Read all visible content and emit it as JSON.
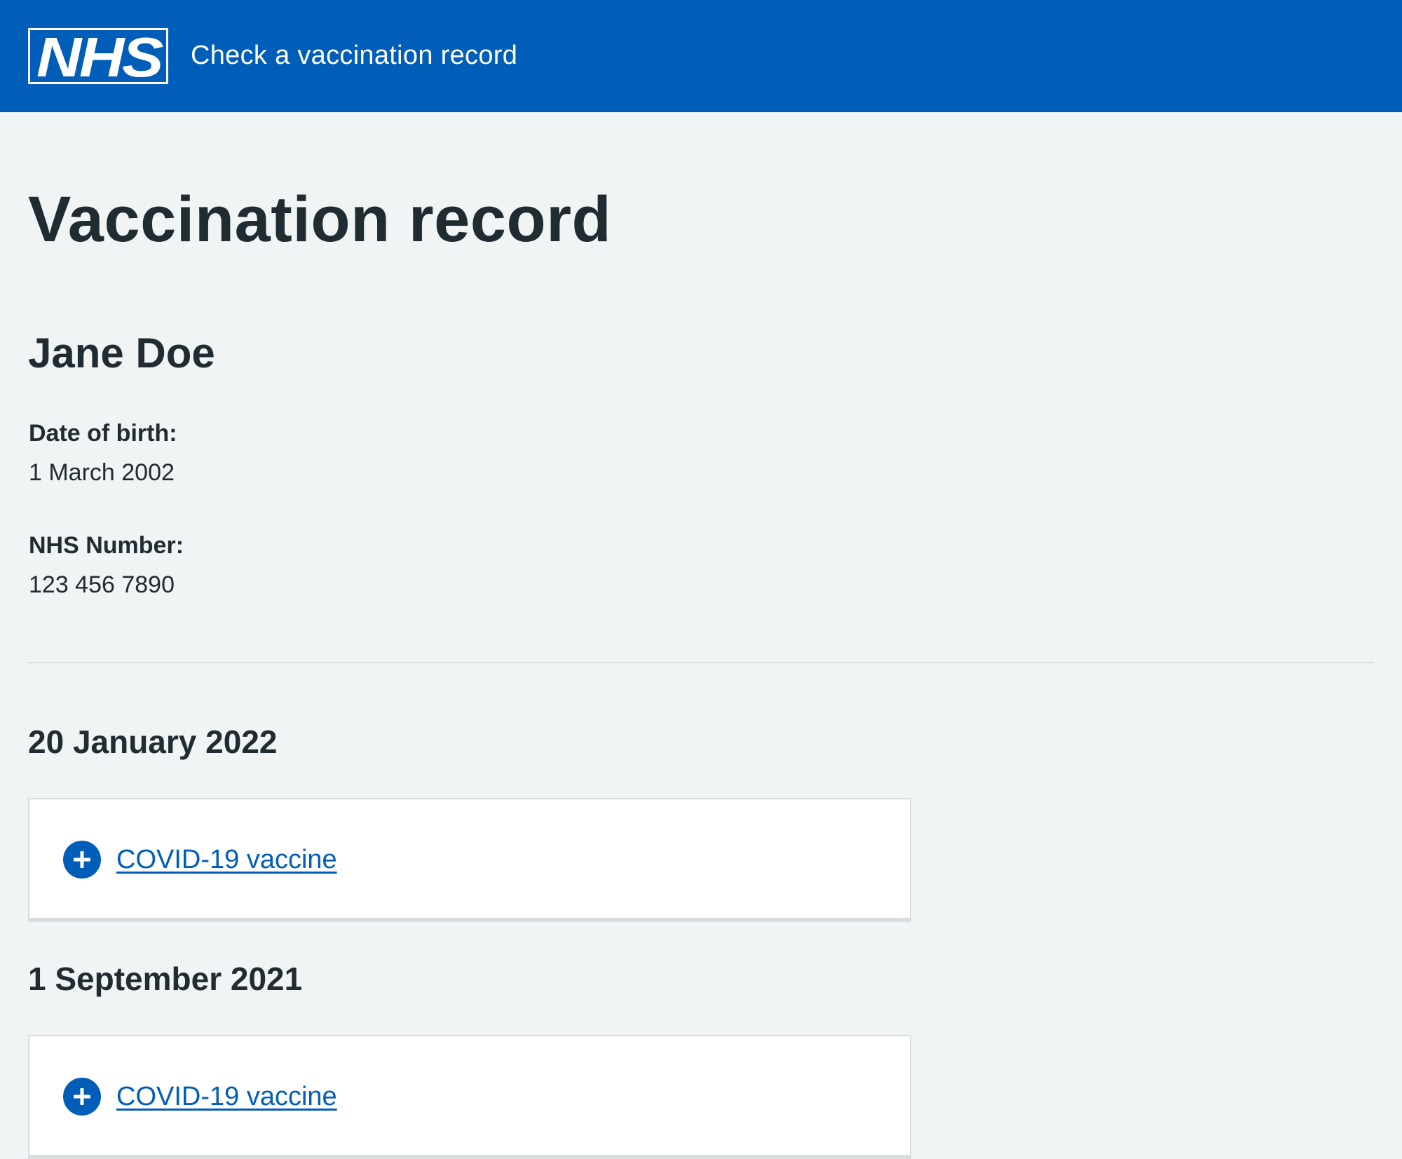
{
  "header": {
    "logo_text": "NHS",
    "service_name": "Check a vaccination record"
  },
  "main": {
    "title": "Vaccination record",
    "person": {
      "name": "Jane Doe",
      "dob_label": "Date of birth:",
      "dob_value": "1 March 2002",
      "nhs_label": "NHS Number:",
      "nhs_value": "123 456 7890"
    },
    "records": [
      {
        "date": "20 January 2022",
        "vaccine": "COVID-19 vaccine",
        "icon": "plus-circle-icon"
      },
      {
        "date": "1 September 2021",
        "vaccine": "COVID-19 vaccine",
        "icon": "plus-circle-icon"
      }
    ]
  },
  "colors": {
    "brand_blue": "#005eb8",
    "background": "#f0f4f5",
    "text": "#212b32",
    "border": "#d8dde0"
  }
}
